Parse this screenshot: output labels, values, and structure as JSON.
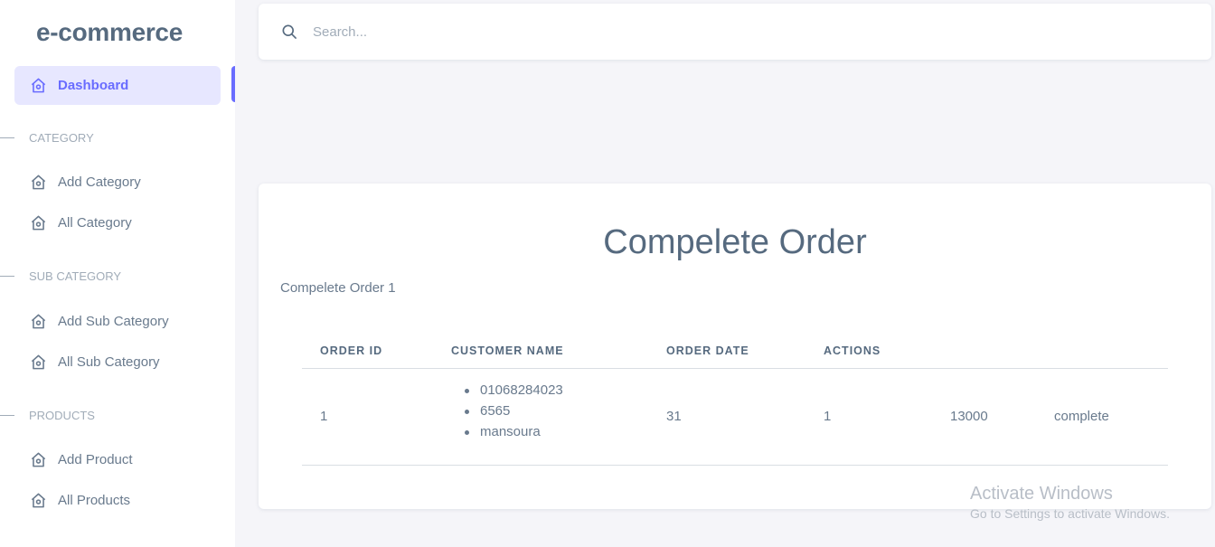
{
  "brand": "e-commerce",
  "sidebar": {
    "dashboard": "Dashboard",
    "sections": [
      {
        "title": "CATEGORY",
        "items": [
          "Add Category",
          "All Category"
        ]
      },
      {
        "title": "SUB CATEGORY",
        "items": [
          "Add Sub Category",
          "All Sub Category"
        ]
      },
      {
        "title": "PRODUCTS",
        "items": [
          "Add Product",
          "All Products"
        ]
      }
    ]
  },
  "search": {
    "placeholder": "Search..."
  },
  "card": {
    "title": "Compelete Order",
    "subtitle": "Compelete Order 1"
  },
  "table": {
    "headers": [
      "ORDER ID",
      "CUSTOMER NAME",
      "ORDER DATE",
      "ACTIONS"
    ],
    "rows": [
      {
        "order_id": "1",
        "customer": [
          "01068284023",
          "6565",
          "mansoura"
        ],
        "order_date": "31",
        "actions": "1",
        "total": "13000",
        "status": "complete"
      }
    ]
  },
  "watermark": {
    "line1": "Activate Windows",
    "line2": "Go to Settings to activate Windows."
  },
  "colors": {
    "accent": "#696cff",
    "active_bg": "#e7e7ff"
  }
}
